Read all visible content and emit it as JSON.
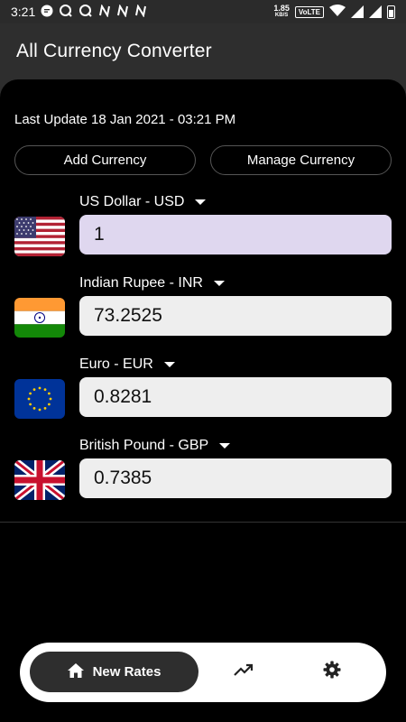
{
  "status_bar": {
    "time": "3:21",
    "net_speed_value": "1.85",
    "net_speed_unit": "KB/S",
    "network_label": "VoLTE"
  },
  "app": {
    "title": "All Currency Converter"
  },
  "main": {
    "last_update": "Last Update 18 Jan 2021 - 03:21 PM",
    "add_currency_label": "Add Currency",
    "manage_currency_label": "Manage Currency",
    "currencies": [
      {
        "name": "US Dollar - USD",
        "value": "1",
        "flag": "us-flag-icon"
      },
      {
        "name": "Indian Rupee - INR",
        "value": "73.2525",
        "flag": "india-flag-icon"
      },
      {
        "name": "Euro - EUR",
        "value": "0.8281",
        "flag": "eu-flag-icon"
      },
      {
        "name": "British Pound - GBP",
        "value": "0.7385",
        "flag": "uk-flag-icon"
      }
    ]
  },
  "bottom_nav": {
    "new_rates_label": "New Rates",
    "icons": [
      "home-icon",
      "trending-icon",
      "settings-icon"
    ]
  },
  "colors": {
    "app_bar": "#2e2e2e",
    "panel": "#000000",
    "active_field": "#dfd7ef",
    "field": "#eeeeee"
  }
}
